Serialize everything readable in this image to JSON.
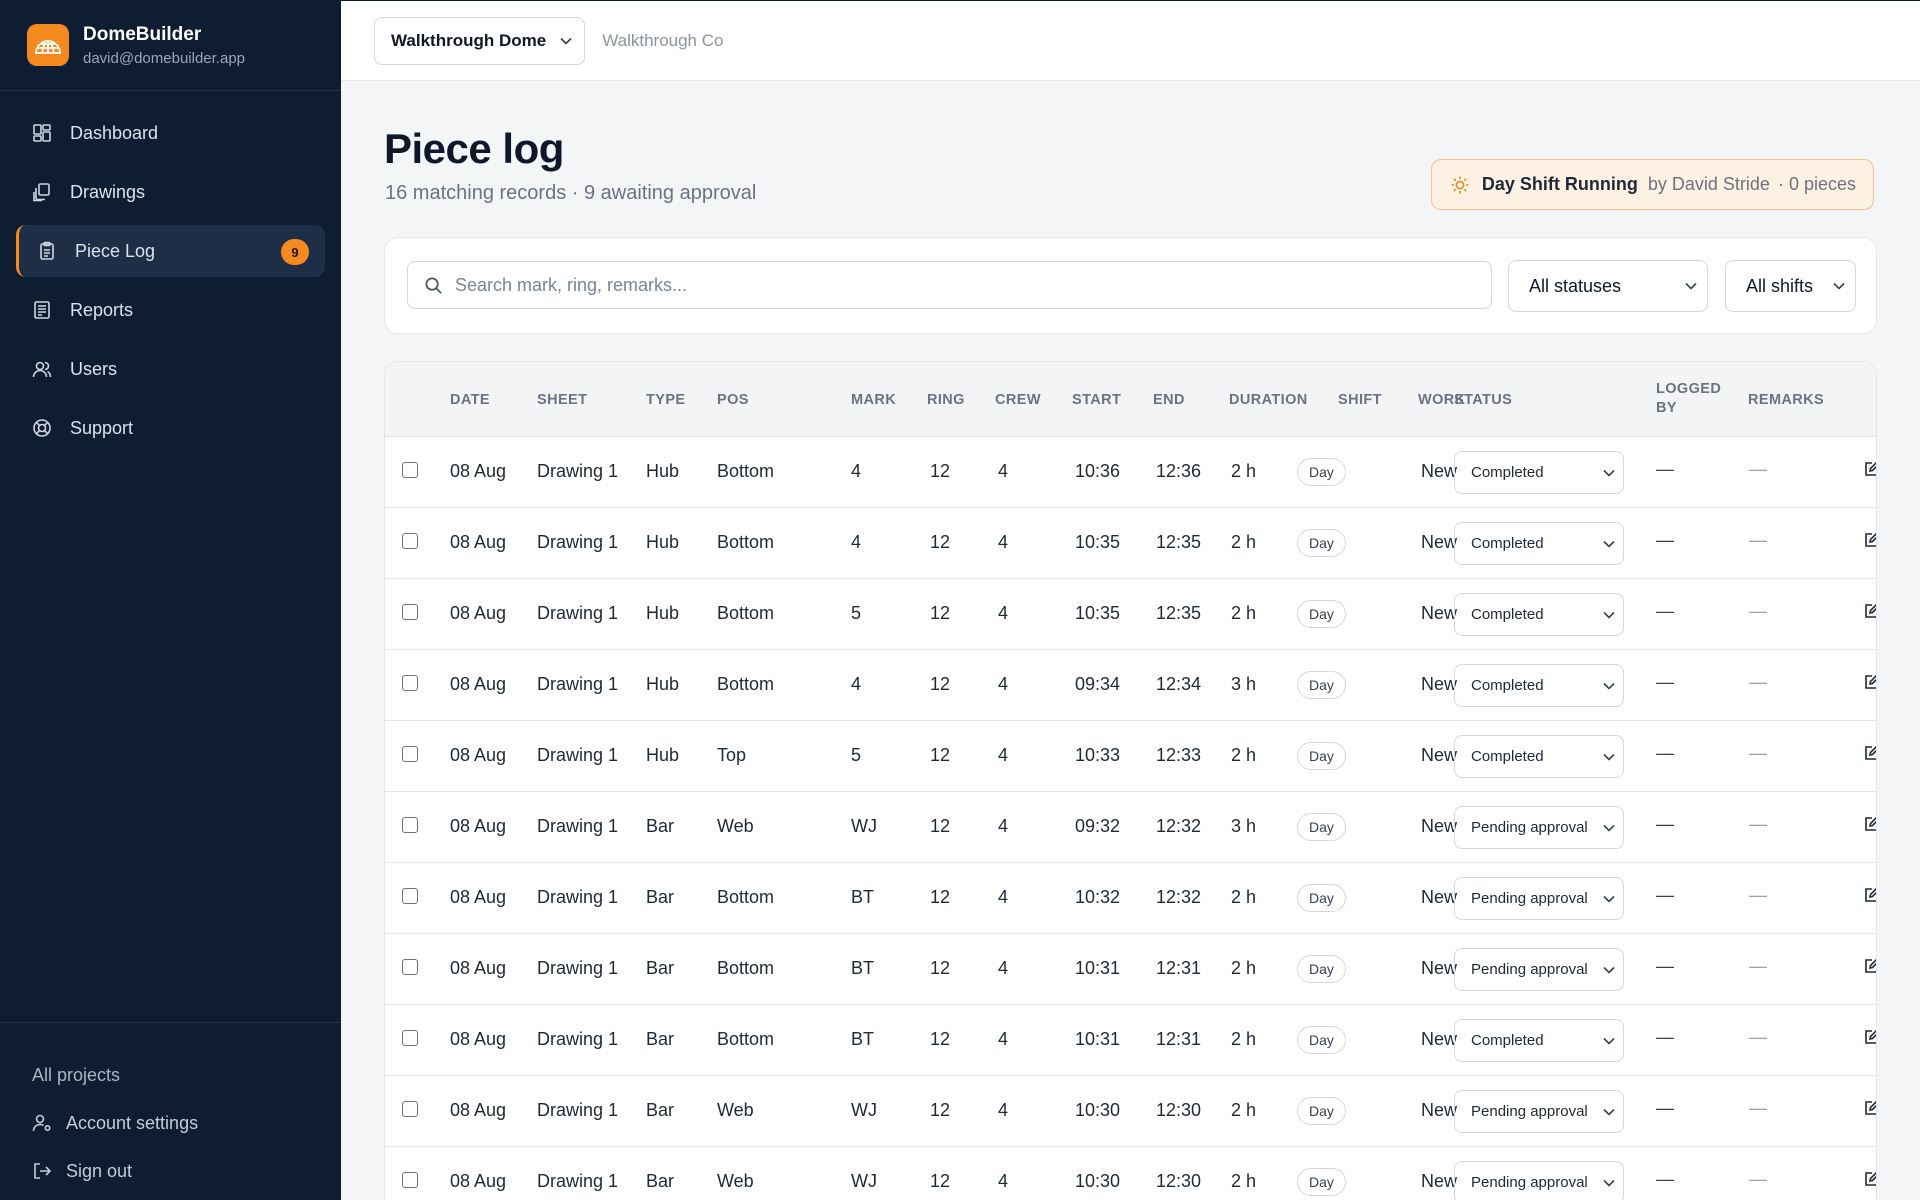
{
  "sidebar": {
    "brand_name": "DomeBuilder",
    "brand_email": "david@domebuilder.app",
    "nav": [
      {
        "label": "Dashboard",
        "icon": "dashboard-icon",
        "active": false
      },
      {
        "label": "Drawings",
        "icon": "drawings-icon",
        "active": false
      },
      {
        "label": "Piece Log",
        "icon": "clipboard-icon",
        "active": true,
        "badge": "9"
      },
      {
        "label": "Reports",
        "icon": "reports-icon",
        "active": false
      },
      {
        "label": "Users",
        "icon": "users-icon",
        "active": false
      },
      {
        "label": "Support",
        "icon": "lifebuoy-icon",
        "active": false
      }
    ],
    "footer": {
      "all_projects": "All projects",
      "account_settings": "Account settings",
      "sign_out": "Sign out"
    }
  },
  "topbar": {
    "project": "Walkthrough Dome",
    "company": "Walkthrough Co"
  },
  "page": {
    "title": "Piece log",
    "subtitle": "16 matching records · 9 awaiting approval"
  },
  "shift": {
    "title": "Day Shift Running",
    "by": "by David Stride",
    "pieces": "· 0 pieces"
  },
  "filters": {
    "search_placeholder": "Search mark, ring, remarks...",
    "status_value": "All statuses",
    "shift_value": "All shifts"
  },
  "table": {
    "headers": {
      "date": "DATE",
      "sheet": "SHEET",
      "type": "TYPE",
      "pos": "POS",
      "mark": "MARK",
      "ring": "RING",
      "crew": "CREW",
      "start": "START",
      "end": "END",
      "duration": "DURATION",
      "shift": "SHIFT",
      "work": "WORK",
      "status": "STATUS",
      "logged_by_1": "LOGGED",
      "logged_by_2": "BY",
      "remarks": "REMARKS"
    },
    "rows": [
      {
        "date": "08 Aug",
        "sheet": "Drawing 1",
        "type": "Hub",
        "pos": "Bottom",
        "mark": "4",
        "ring": "12",
        "crew": "4",
        "start": "10:36",
        "end": "12:36",
        "duration": "2 h",
        "shift": "Day",
        "work": "New",
        "status": "Completed",
        "logged_by": "—",
        "remarks": "—"
      },
      {
        "date": "08 Aug",
        "sheet": "Drawing 1",
        "type": "Hub",
        "pos": "Bottom",
        "mark": "4",
        "ring": "12",
        "crew": "4",
        "start": "10:35",
        "end": "12:35",
        "duration": "2 h",
        "shift": "Day",
        "work": "New",
        "status": "Completed",
        "logged_by": "—",
        "remarks": "—"
      },
      {
        "date": "08 Aug",
        "sheet": "Drawing 1",
        "type": "Hub",
        "pos": "Bottom",
        "mark": "5",
        "ring": "12",
        "crew": "4",
        "start": "10:35",
        "end": "12:35",
        "duration": "2 h",
        "shift": "Day",
        "work": "New",
        "status": "Completed",
        "logged_by": "—",
        "remarks": "—"
      },
      {
        "date": "08 Aug",
        "sheet": "Drawing 1",
        "type": "Hub",
        "pos": "Bottom",
        "mark": "4",
        "ring": "12",
        "crew": "4",
        "start": "09:34",
        "end": "12:34",
        "duration": "3 h",
        "shift": "Day",
        "work": "New",
        "status": "Completed",
        "logged_by": "—",
        "remarks": "—"
      },
      {
        "date": "08 Aug",
        "sheet": "Drawing 1",
        "type": "Hub",
        "pos": "Top",
        "mark": "5",
        "ring": "12",
        "crew": "4",
        "start": "10:33",
        "end": "12:33",
        "duration": "2 h",
        "shift": "Day",
        "work": "New",
        "status": "Completed",
        "logged_by": "—",
        "remarks": "—"
      },
      {
        "date": "08 Aug",
        "sheet": "Drawing 1",
        "type": "Bar",
        "pos": "Web",
        "mark": "WJ",
        "ring": "12",
        "crew": "4",
        "start": "09:32",
        "end": "12:32",
        "duration": "3 h",
        "shift": "Day",
        "work": "New",
        "status": "Pending approval",
        "logged_by": "—",
        "remarks": "—"
      },
      {
        "date": "08 Aug",
        "sheet": "Drawing 1",
        "type": "Bar",
        "pos": "Bottom",
        "mark": "BT",
        "ring": "12",
        "crew": "4",
        "start": "10:32",
        "end": "12:32",
        "duration": "2 h",
        "shift": "Day",
        "work": "New",
        "status": "Pending approval",
        "logged_by": "—",
        "remarks": "—"
      },
      {
        "date": "08 Aug",
        "sheet": "Drawing 1",
        "type": "Bar",
        "pos": "Bottom",
        "mark": "BT",
        "ring": "12",
        "crew": "4",
        "start": "10:31",
        "end": "12:31",
        "duration": "2 h",
        "shift": "Day",
        "work": "New",
        "status": "Pending approval",
        "logged_by": "—",
        "remarks": "—"
      },
      {
        "date": "08 Aug",
        "sheet": "Drawing 1",
        "type": "Bar",
        "pos": "Bottom",
        "mark": "BT",
        "ring": "12",
        "crew": "4",
        "start": "10:31",
        "end": "12:31",
        "duration": "2 h",
        "shift": "Day",
        "work": "New",
        "status": "Completed",
        "logged_by": "—",
        "remarks": "—"
      },
      {
        "date": "08 Aug",
        "sheet": "Drawing 1",
        "type": "Bar",
        "pos": "Web",
        "mark": "WJ",
        "ring": "12",
        "crew": "4",
        "start": "10:30",
        "end": "12:30",
        "duration": "2 h",
        "shift": "Day",
        "work": "New",
        "status": "Pending approval",
        "logged_by": "—",
        "remarks": "—"
      },
      {
        "date": "08 Aug",
        "sheet": "Drawing 1",
        "type": "Bar",
        "pos": "Web",
        "mark": "WJ",
        "ring": "12",
        "crew": "4",
        "start": "10:30",
        "end": "12:30",
        "duration": "2 h",
        "shift": "Day",
        "work": "New",
        "status": "Pending approval",
        "logged_by": "—",
        "remarks": "—"
      }
    ]
  },
  "colors": {
    "sidebar_bg": "#0f1d33",
    "accent": "#f58a1f"
  }
}
